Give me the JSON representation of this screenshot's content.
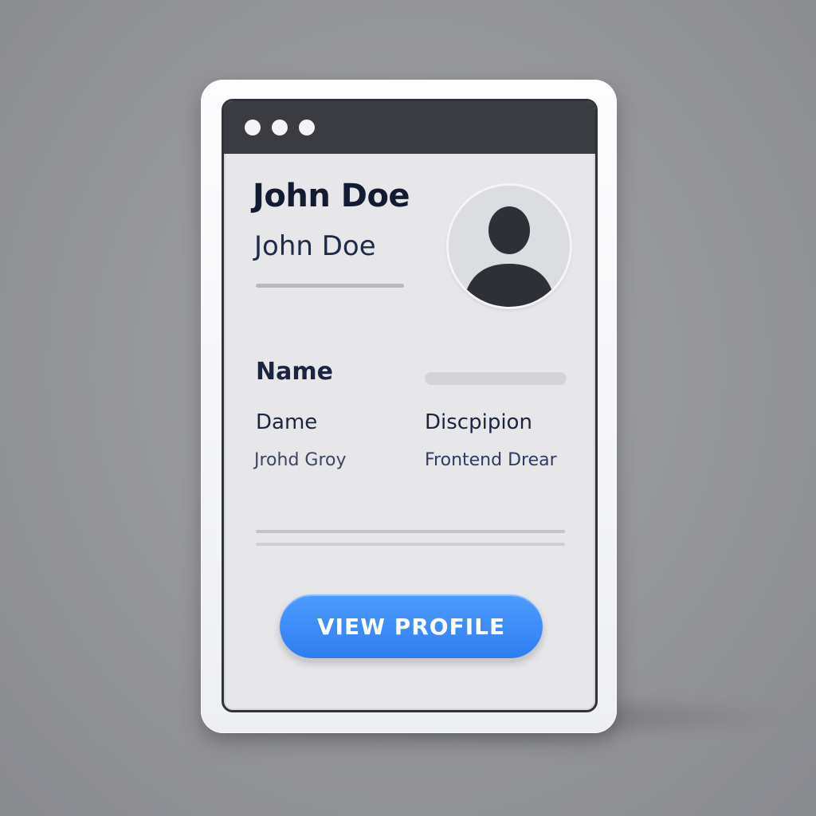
{
  "window": {
    "controls": [
      "window-dot",
      "window-dot",
      "window-dot"
    ]
  },
  "profile": {
    "title": "John Doe",
    "subtitle": "John Doe",
    "avatar_icon": "user-avatar-icon"
  },
  "details": {
    "name_label": "Name",
    "left_label": "Dame",
    "right_label": "Discpipion",
    "left_value": "Jrohd Groy",
    "right_value": "Frontend Drear"
  },
  "actions": {
    "view_profile_label": "VIEW PROFILE"
  },
  "colors": {
    "accent": "#3a8bf7",
    "titlebar": "#3a3c42",
    "background": "#939498"
  }
}
